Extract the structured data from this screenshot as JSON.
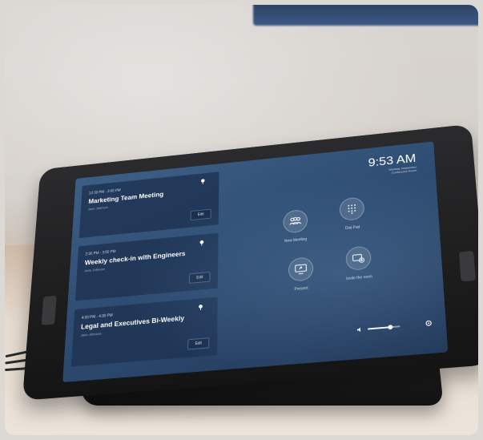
{
  "meetings": [
    {
      "time": "12:30 PM - 2:00 PM",
      "title": "Marketing Team Meeting",
      "sub": "Jane Johnson",
      "edit": "Edit"
    },
    {
      "time": "2:30 PM - 3:00 PM",
      "title": "Weekly check-in with Engineers",
      "sub": "Jane Johnson",
      "edit": "Edit"
    },
    {
      "time": "4:00 PM - 4:30 PM",
      "title": "Legal and Executives Bi-Weekly",
      "sub": "Jane Johnson",
      "edit": "Edit"
    }
  ],
  "clock": {
    "time": "9:53 AM",
    "date_line1": "Monday, September",
    "date_line2": "Conference Room"
  },
  "actions": [
    {
      "label": "New Meeting",
      "icon": "people-icon"
    },
    {
      "label": "Dial Pad",
      "icon": "keypad-icon"
    },
    {
      "label": "Present",
      "icon": "screen-share-icon"
    },
    {
      "label": "Invite the room",
      "icon": "invite-room-icon"
    }
  ],
  "volume": {
    "level": 0.7
  },
  "colors": {
    "screen": "#2f4d73",
    "card": "#1e3454",
    "bezel": "#141415"
  }
}
